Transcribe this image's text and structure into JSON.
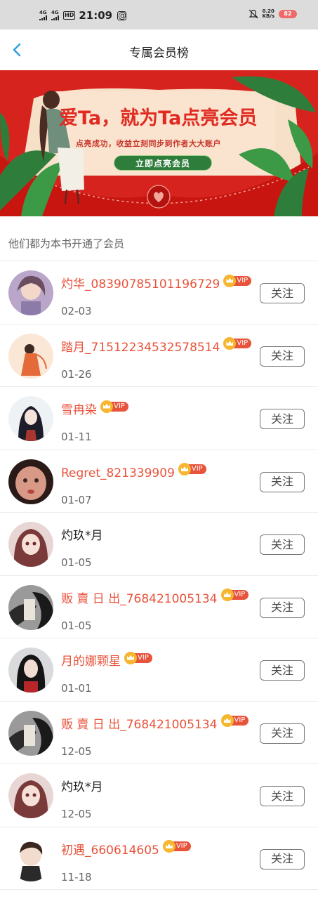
{
  "status_bar": {
    "net1": "4G",
    "net2": "4G",
    "hd": "HD",
    "time": "21:09",
    "speed_value": "0.20",
    "speed_unit": "KB/s",
    "battery": "82",
    "battery_color": "#f06a6a"
  },
  "nav": {
    "title": "专属会员榜",
    "back_icon": "chevron-left-icon",
    "accent": "#2a9be3"
  },
  "banner": {
    "headline": "爱Ta，就为Ta点亮会员",
    "subline": "点亮成功，收益立刻同步到作者大大账户",
    "cta": "立即点亮会员",
    "bg_color": "#d7231e"
  },
  "section": {
    "title": "他们都为本书开通了会员"
  },
  "vip_label": "VIP",
  "follow_label": "关注",
  "members": [
    {
      "name": "灼华_08390785101196729",
      "date": "02-03",
      "vip": true,
      "avatar": "a1"
    },
    {
      "name": "踏月_71512234532578514",
      "date": "01-26",
      "vip": true,
      "avatar": "a2"
    },
    {
      "name": "雪冉染",
      "date": "01-11",
      "vip": true,
      "avatar": "a3"
    },
    {
      "name": "Regret_821339909",
      "date": "01-07",
      "vip": true,
      "avatar": "a4"
    },
    {
      "name": "灼玖*月",
      "date": "01-05",
      "vip": false,
      "avatar": "a5"
    },
    {
      "name": "贩 賣 日 出_768421005134",
      "date": "01-05",
      "vip": true,
      "avatar": "a6"
    },
    {
      "name": "月的娜颗星",
      "date": "01-01",
      "vip": true,
      "avatar": "a7"
    },
    {
      "name": "贩 賣 日 出_768421005134",
      "date": "12-05",
      "vip": true,
      "avatar": "a6"
    },
    {
      "name": "灼玖*月",
      "date": "12-05",
      "vip": false,
      "avatar": "a5"
    },
    {
      "name": "初遇_660614605",
      "date": "11-18",
      "vip": true,
      "avatar": "a8"
    }
  ]
}
